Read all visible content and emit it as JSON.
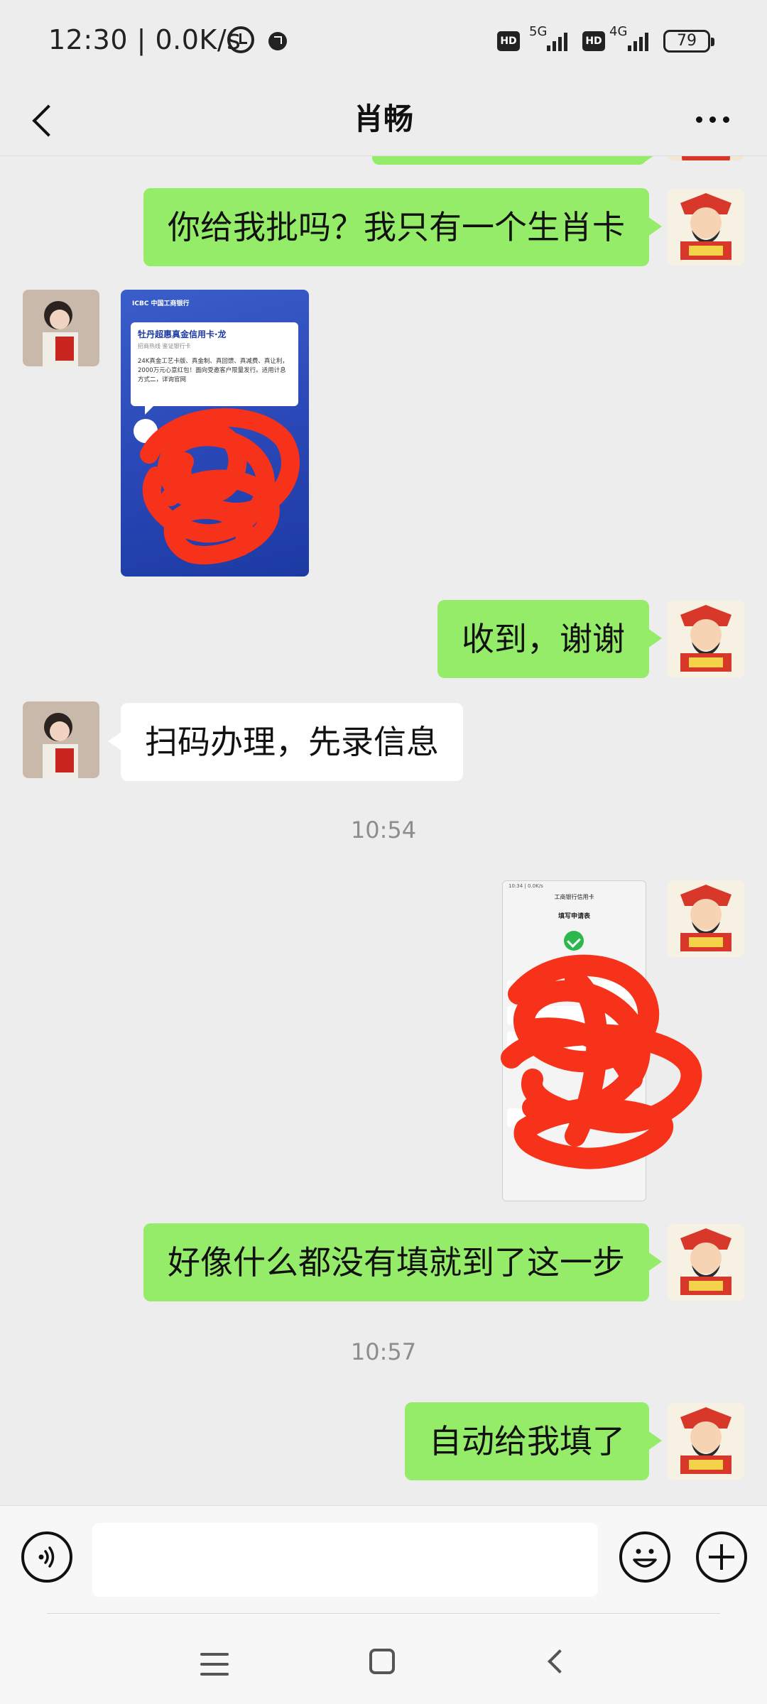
{
  "status_bar": {
    "time": "12:30 | 0.0K/s",
    "network_1": "5G",
    "network_2": "4G",
    "hd_label": "HD",
    "battery": "79"
  },
  "header": {
    "title": "肖畅",
    "back_icon": "chevron-left-icon",
    "more_icon": "more-dots-icon"
  },
  "messages": [
    {
      "id": "m1",
      "sender": "me",
      "type": "text",
      "text": "你给我批吗？我只有一个生肖卡"
    },
    {
      "id": "m2",
      "sender": "other",
      "type": "image",
      "image": {
        "bank_name": "ICBC 中国工商银行",
        "card_title": "牡丹超惠真金信用卡·龙",
        "card_sub": "招商热线 鉴证银行卡",
        "card_body": "24K真金工艺卡版、真金制、真回馈、真减费、真让利，2000万元心意红包！面向受邀客户限量发行。适用计息方式二，详询官网"
      }
    },
    {
      "id": "m3",
      "sender": "me",
      "type": "text",
      "text": "收到，谢谢"
    },
    {
      "id": "m4",
      "sender": "other",
      "type": "text",
      "text": "扫码办理，先录信息"
    },
    {
      "id": "t1",
      "type": "timestamp",
      "text": "10:54"
    },
    {
      "id": "m5",
      "sender": "me",
      "type": "image",
      "image": {
        "status": "10:34 | 0.0K/s",
        "title_bar": "工商银行信用卡",
        "page_title": "填写申请表",
        "success_text": "提交成功"
      }
    },
    {
      "id": "m6",
      "sender": "me",
      "type": "text",
      "text": "好像什么都没有填就到了这一步"
    },
    {
      "id": "t2",
      "type": "timestamp",
      "text": "10:57"
    },
    {
      "id": "m7",
      "sender": "me",
      "type": "text",
      "text": "自动给我填了"
    }
  ],
  "input_bar": {
    "voice_icon": "voice-icon",
    "input_value": "",
    "emoji_icon": "emoji-icon",
    "plus_icon": "plus-icon"
  },
  "nav_bar": {
    "menu_icon": "menu-icon",
    "home_icon": "home-icon",
    "back_icon": "back-icon"
  },
  "colors": {
    "background": "#ededed",
    "my_bubble": "#95ec69",
    "other_bubble": "#ffffff",
    "scribble": "#f7321a",
    "card_blue": "#2947b6"
  }
}
